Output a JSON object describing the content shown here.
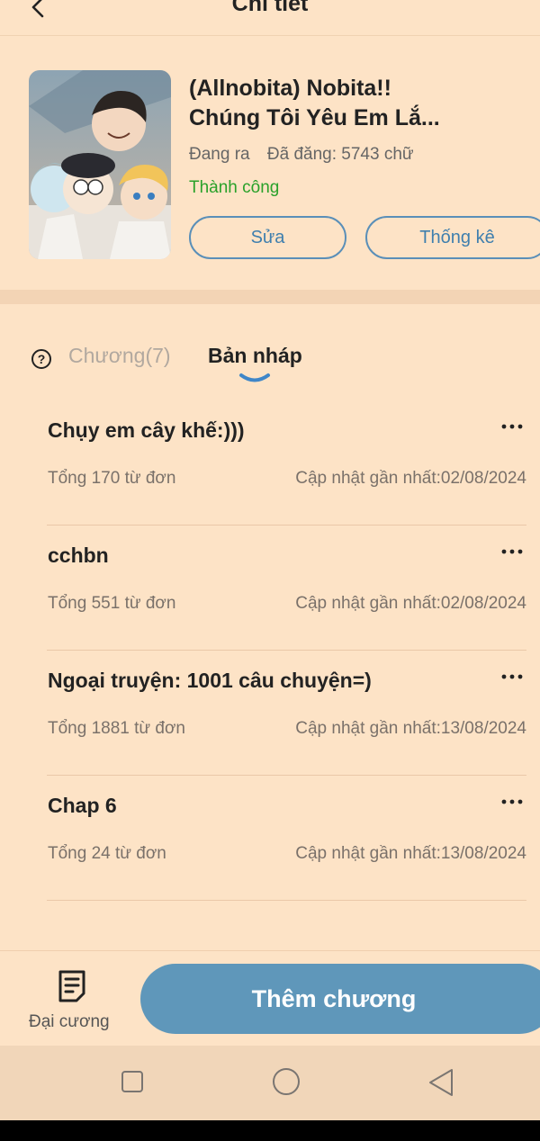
{
  "header": {
    "title": "Chi tiết"
  },
  "book": {
    "title_line1": "(Allnobita) Nobita!!",
    "title_line2": "Chúng Tôi Yêu Em Lắ...",
    "status": "Đang ra",
    "published": "Đã đăng: 5743 chữ",
    "review_status": "Thành công",
    "edit_label": "Sửa",
    "stats_label": "Thống kê"
  },
  "tabs": {
    "chapters_label": "Chương(7)",
    "drafts_label": "Bản nháp"
  },
  "drafts": [
    {
      "title": "Chụy em cây khế:)))",
      "total": "Tổng 170 từ đơn",
      "updated": "Cập nhật gần nhất:02/08/2024"
    },
    {
      "title": "cchbn",
      "total": "Tổng 551 từ đơn",
      "updated": "Cập nhật gần nhất:02/08/2024"
    },
    {
      "title": "Ngoại truyện: 1001 câu chuyện=)",
      "total": "Tổng 1881 từ đơn",
      "updated": "Cập nhật gần nhất:13/08/2024"
    },
    {
      "title": "Chap 6",
      "total": "Tổng 24 từ đơn",
      "updated": "Cập nhật gần nhất:13/08/2024"
    }
  ],
  "bottom": {
    "outline_label": "Đại cương",
    "add_chapter_label": "Thêm chương"
  },
  "colors": {
    "background": "#fde3c6",
    "accent_blue": "#5f97ba",
    "success_green": "#2aa12a"
  }
}
